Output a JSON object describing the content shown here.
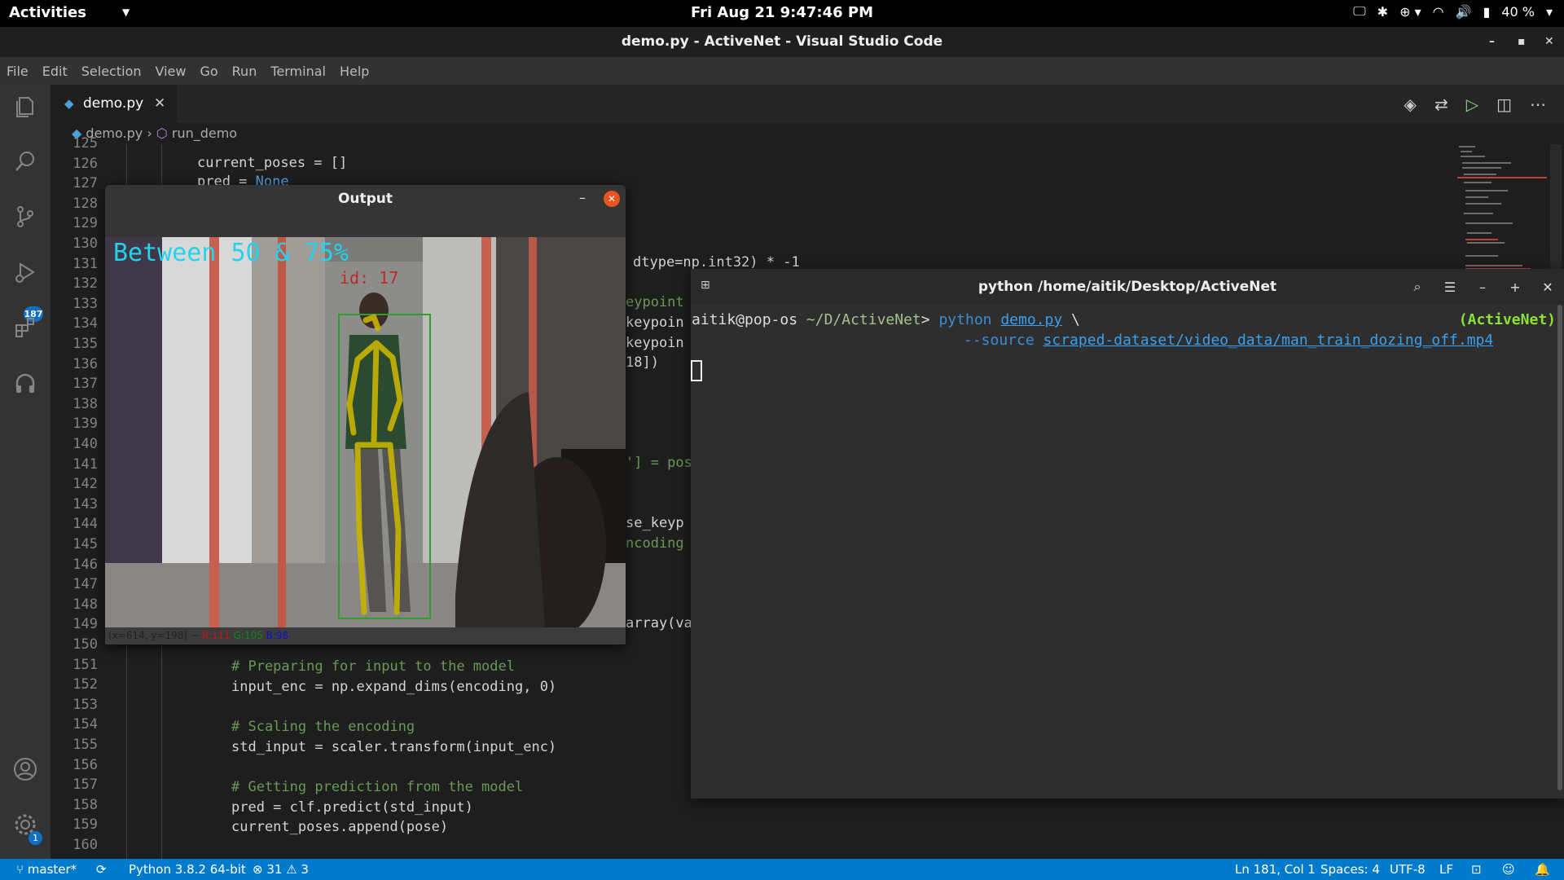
{
  "topbar": {
    "activities": "Activities",
    "clock": "Fri Aug 21  9:47:46 PM",
    "battery": "40 %"
  },
  "vscode": {
    "title": "demo.py - ActiveNet - Visual Studio Code",
    "menu": [
      "File",
      "Edit",
      "Selection",
      "View",
      "Go",
      "Run",
      "Terminal",
      "Help"
    ],
    "tab": "demo.py",
    "breadcrumb": {
      "file": "demo.py",
      "symbol": "run_demo"
    },
    "scm_badge": "187",
    "settings_badge": "1"
  },
  "editor": {
    "line_numbers": [
      "125",
      "126",
      "127",
      "128",
      "129",
      "130",
      "131",
      "132",
      "133",
      "134",
      "135",
      "136",
      "137",
      "138",
      "139",
      "140",
      "141",
      "142",
      "143",
      "144",
      "145",
      "146",
      "147",
      "148",
      "149",
      "150",
      "151",
      "152",
      "153",
      "154",
      "155",
      "156",
      "157",
      "158",
      "159",
      "160"
    ],
    "lines": {
      "l126": "current_poses = []",
      "l127a": "pred = ",
      "l127b": "None",
      "l131": "dtype=np.int32) * -1",
      "l133": "eypoint",
      "l134": "keypoin",
      "l135": "keypoin",
      "l136": "18])",
      "l141": "'] = pos",
      "l144": "se_keyp",
      "l145": "ncoding",
      "l149": "array(va",
      "l151": "# Preparing for input to the model",
      "l152": "input_enc = np.expand_dims(encoding, 0)",
      "l154": "# Scaling the encoding",
      "l155": "std_input = scaler.transform(input_enc)",
      "l157": "# Getting prediction from the model",
      "l158": "pred = clf.predict(std_input)",
      "l159": "current_poses.append(pose)"
    }
  },
  "output_window": {
    "title": "Output",
    "overlay": "Between 50 & 75%",
    "id_label": "id: 17",
    "status_xy": "(x=614, y=198) ~",
    "status_r": "R:111",
    "status_g": "G:105",
    "status_b": "B:98"
  },
  "terminal": {
    "title": "python /home/aitik/Desktop/ActiveNet",
    "user": "aitik@pop-os",
    "cwd": "~/D/ActiveNet",
    "prompt": ">",
    "cmd": "python",
    "script": "demo.py",
    "continuation": "\\",
    "flag": "--source",
    "source": "scraped-dataset/video_data/man_train_dozing_off.mp4",
    "env": "(ActiveNet)"
  },
  "statusbar": {
    "branch": "master*",
    "interpreter": "Python 3.8.2 64-bit",
    "errors": "31",
    "warnings": "3",
    "position": "Ln 181, Col 1",
    "spaces": "Spaces: 4",
    "encoding": "UTF-8",
    "eol": "LF"
  },
  "colors": {
    "statusbar": "#007acc",
    "accent_close": "#e95420",
    "overlay_text": "#22d3ee",
    "skeleton": "#c8b400",
    "bbox": "#2e9e2e"
  }
}
